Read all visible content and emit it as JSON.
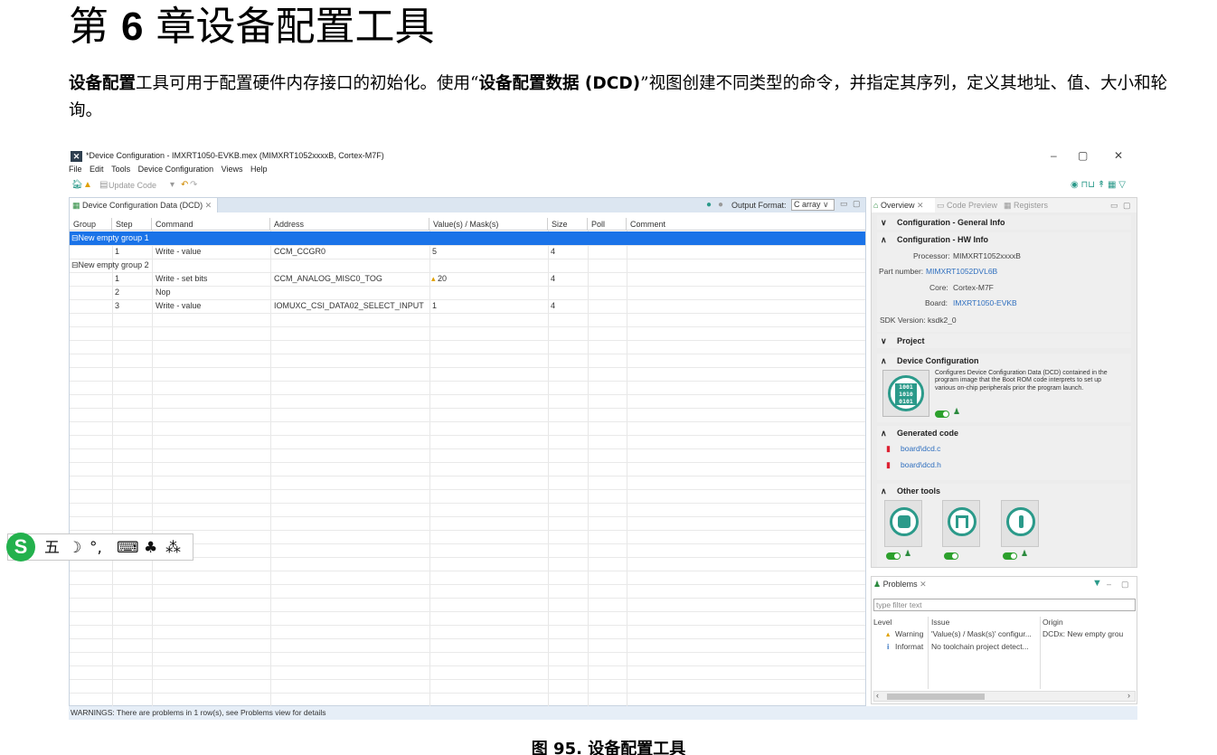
{
  "doc": {
    "title_prefix": "第",
    "title_num": "6",
    "title_rest": "章设备配置工具",
    "para": {
      "p1": "设备配置",
      "p2": "工具可用于配置硬件内存接口的初始化。使用“",
      "p3": "设备配置数据 (DCD)",
      "p4": "”视图创建不同类型的命令，并指定其序列，定义其地址、值、大小和轮询。"
    },
    "caption": "图 95. 设备配置工具"
  },
  "app": {
    "window_title": "*Device Configuration - IMXRT1050-EVKB.mex (MIMXRT1052xxxxB, Cortex-M7F)",
    "window_controls": [
      "–",
      "▢",
      "✕"
    ],
    "menu": [
      "File",
      "Edit",
      "Tools",
      "Device Configuration",
      "Views",
      "Help"
    ],
    "toolbar": {
      "update_code": "Update Code",
      "right_icons": "◉ ⊓⊔ ↟ ▦ ▽"
    },
    "editor": {
      "tab_label": "Device Configuration Data (DCD)",
      "output_format_label": "Output Format:",
      "output_format_value": "C array",
      "columns": [
        "Group",
        "Step",
        "Command",
        "Address",
        "Value(s) / Mask(s)",
        "Size",
        "Poll",
        "Comment"
      ],
      "rows": [
        {
          "group": "⊟New empty group 1"
        },
        {
          "step": "1",
          "command": "Write - value",
          "address": "CCM_CCGR0",
          "value": "5",
          "size": "4"
        },
        {
          "group": "⊟New empty group 2"
        },
        {
          "step": "1",
          "command": "Write - set bits",
          "address": "CCM_ANALOG_MISC0_TOG",
          "value": "20",
          "size": "4"
        },
        {
          "step": "2",
          "command": "Nop"
        },
        {
          "step": "3",
          "command": "Write - value",
          "address": "IOMUXC_CSI_DATA02_SELECT_INPUT",
          "value": "1",
          "size": "4"
        }
      ],
      "status": "WARNINGS: There are problems in 1 row(s), see Problems view for details"
    },
    "overview": {
      "tabs": [
        "Overview",
        "Code Preview",
        "Registers"
      ],
      "general_info": "Configuration - General Info",
      "hw_info": "Configuration - HW Info",
      "processor_label": "Processor:",
      "processor": "MIMXRT1052xxxxB",
      "part_label": "Part number:",
      "part": "MIMXRT1052DVL6B",
      "core_label": "Core:",
      "core": "Cortex-M7F",
      "board_label": "Board:",
      "board": "IMXRT1050-EVKB",
      "sdk_label": "SDK Version:",
      "sdk": "ksdk2_0",
      "project": "Project",
      "device_config": "Device Configuration",
      "device_config_desc": "Configures Device Configuration Data (DCD) contained in the program image that the Boot ROM code interprets to set up various on-chip peripherals prior the program launch.",
      "dcd_icon_text": "1001 1010 0101",
      "generated_code": "Generated code",
      "files": [
        "board\\dcd.c",
        "board\\dcd.h"
      ],
      "other_tools": "Other tools"
    },
    "problems": {
      "tab": "Problems",
      "filter_placeholder": "type filter text",
      "columns": [
        "Level",
        "Issue",
        "Origin"
      ],
      "rows": [
        {
          "level": "Warning",
          "issue": "'Value(s) / Mask(s)' configur...",
          "origin": "DCDx: New empty grou"
        },
        {
          "level": "Informat",
          "issue": "No toolchain project detect...",
          "origin": ""
        }
      ]
    }
  },
  "ime": {
    "logo": "S",
    "items": [
      "五",
      "☽",
      "°,",
      "⌨",
      "♣",
      "⁂"
    ]
  },
  "colors": {
    "selection": "#1a73e8",
    "accent": "#2b9a8a",
    "link": "#2f6fbf"
  }
}
